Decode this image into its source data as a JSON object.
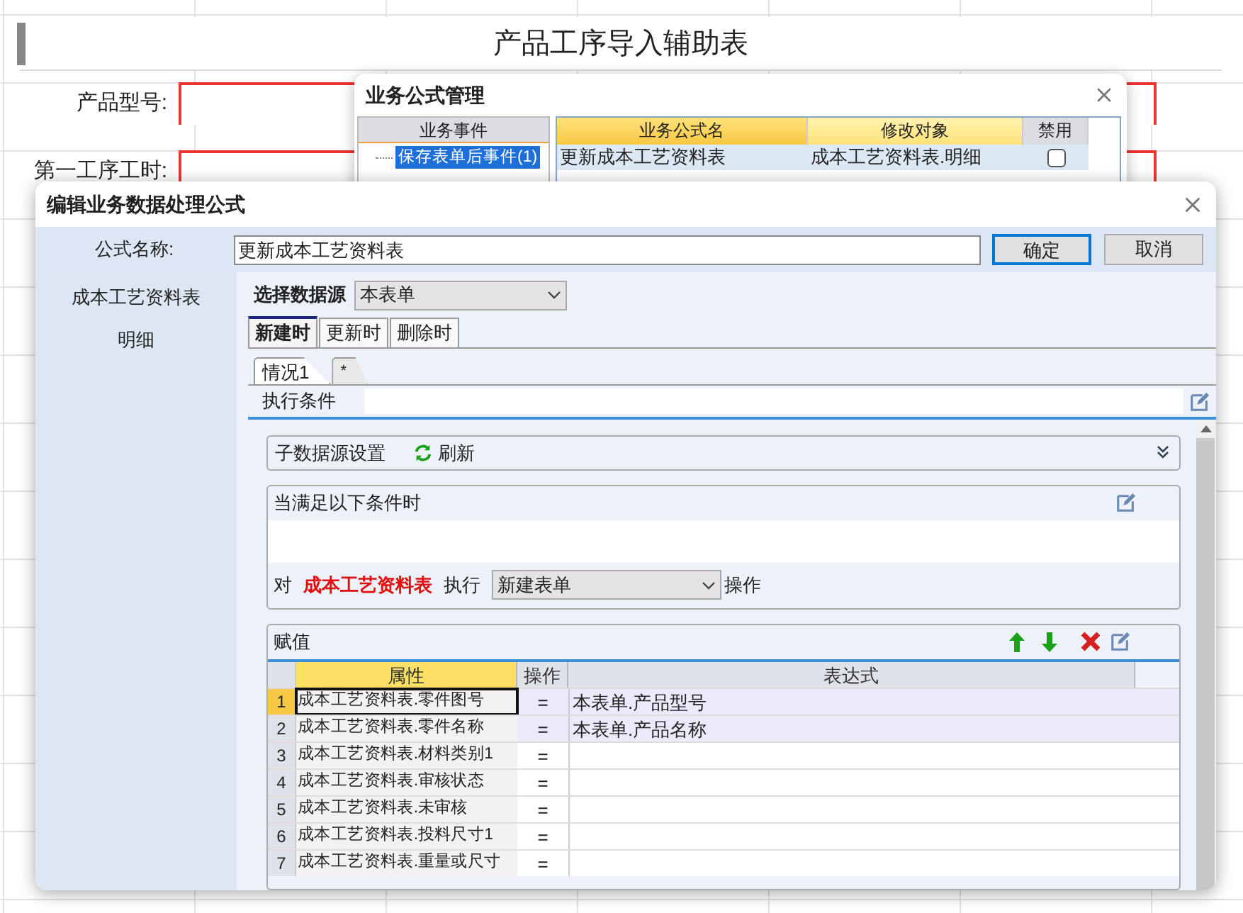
{
  "sheet": {
    "title": "产品工序导入辅助表",
    "fields": [
      {
        "label": "产品型号:"
      },
      {
        "label": "第一工序工时:"
      }
    ]
  },
  "manager_dialog": {
    "title": "业务公式管理",
    "events_heading": "业务事件",
    "events": [
      {
        "label": "保存表单后事件(1)",
        "selected": true
      }
    ],
    "columns": [
      "业务公式名",
      "修改对象",
      "禁用"
    ],
    "rows": [
      {
        "name": "更新成本工艺资料表",
        "target": "成本工艺资料表.明细",
        "disabled": false
      }
    ]
  },
  "editor_dialog": {
    "title": "编辑业务数据处理公式",
    "name_label": "公式名称:",
    "name_value": "更新成本工艺资料表",
    "buttons": [
      "确定",
      "取消"
    ],
    "sidebar": [
      {
        "label": "成本工艺资料表"
      },
      {
        "label": "明细"
      }
    ],
    "datasource_label": "选择数据源",
    "datasource_value": "本表单",
    "tabs": [
      {
        "label": "新建时",
        "selected": true
      },
      {
        "label": "更新时",
        "selected": false
      },
      {
        "label": "删除时",
        "selected": false
      }
    ],
    "case_tabs": [
      {
        "label": "情况1",
        "selected": true
      },
      {
        "label": "*",
        "selected": false
      }
    ],
    "condition_label": "执行条件",
    "sub_source": {
      "label": "子数据源设置",
      "refresh": "刷新"
    },
    "when": {
      "title": "当满足以下条件时",
      "prefix": "对",
      "table_name": "成本工艺资料表",
      "exec": "执行",
      "action": "新建表单",
      "suffix": "操作"
    },
    "assign": {
      "title": "赋值",
      "columns": [
        "属性",
        "操作",
        "表达式"
      ],
      "rows": [
        {
          "index": "1",
          "property": "成本工艺资料表.零件图号",
          "op": "=",
          "expression": "本表单.产品型号",
          "selected": true
        },
        {
          "index": "2",
          "property": "成本工艺资料表.零件名称",
          "op": "=",
          "expression": "本表单.产品名称",
          "selected": false
        },
        {
          "index": "3",
          "property": "成本工艺资料表.材料类别1",
          "op": "=",
          "expression": "",
          "selected": false
        },
        {
          "index": "4",
          "property": "成本工艺资料表.审核状态",
          "op": "=",
          "expression": "",
          "selected": false
        },
        {
          "index": "5",
          "property": "成本工艺资料表.未审核",
          "op": "=",
          "expression": "",
          "selected": false
        },
        {
          "index": "6",
          "property": "成本工艺资料表.投料尺寸1",
          "op": "=",
          "expression": "",
          "selected": false
        },
        {
          "index": "7",
          "property": "成本工艺资料表.重量或尺寸",
          "op": "=",
          "expression": "",
          "selected": false
        }
      ]
    }
  }
}
